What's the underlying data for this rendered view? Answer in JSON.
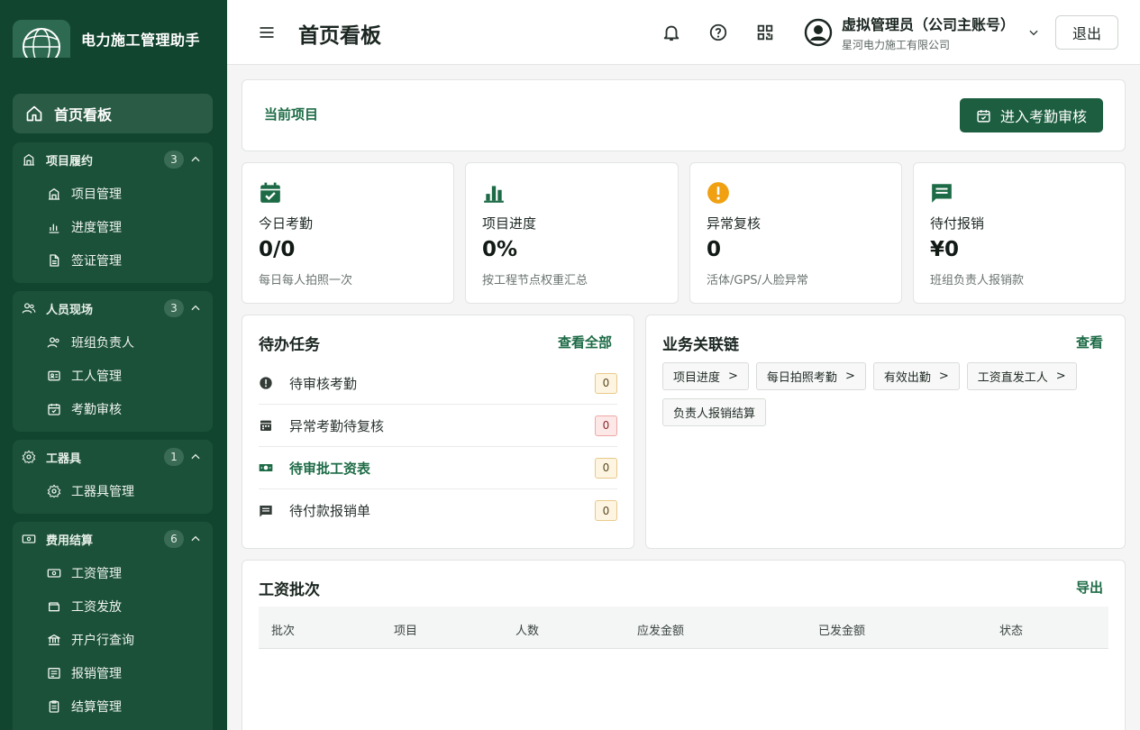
{
  "colors": {
    "sidebar_bg": "#12452f",
    "accent": "#1d6b46",
    "primary_button": "#1c5e3f",
    "warning": "#f0a011"
  },
  "app": {
    "title": "电力施工管理助手"
  },
  "sidebar": {
    "home": {
      "label": "首页看板",
      "icon": "home-icon"
    },
    "groups": [
      {
        "label": "项目履约",
        "count": "3",
        "icon": "building-icon",
        "items": [
          {
            "label": "项目管理",
            "icon": "building-icon"
          },
          {
            "label": "进度管理",
            "icon": "bar-chart-icon"
          },
          {
            "label": "签证管理",
            "icon": "document-icon"
          }
        ]
      },
      {
        "label": "人员现场",
        "count": "3",
        "icon": "users-icon",
        "items": [
          {
            "label": "班组负责人",
            "icon": "users-icon"
          },
          {
            "label": "工人管理",
            "icon": "id-card-icon"
          },
          {
            "label": "考勤审核",
            "icon": "calendar-check-icon"
          }
        ]
      },
      {
        "label": "工器具",
        "count": "1",
        "icon": "gear-icon",
        "items": [
          {
            "label": "工器具管理",
            "icon": "gear-icon"
          }
        ]
      },
      {
        "label": "费用结算",
        "count": "6",
        "icon": "money-icon",
        "items": [
          {
            "label": "工资管理",
            "icon": "money-icon"
          },
          {
            "label": "工资发放",
            "icon": "wallet-icon"
          },
          {
            "label": "开户行查询",
            "icon": "bank-icon"
          },
          {
            "label": "报销管理",
            "icon": "receipt-icon"
          },
          {
            "label": "结算管理",
            "icon": "clipboard-icon"
          }
        ]
      }
    ]
  },
  "header": {
    "page_title": "首页看板",
    "user_name": "虚拟管理员（公司主账号）",
    "org": "星河电力施工有限公司",
    "logout": "退出"
  },
  "project_bar": {
    "label": "当前项目",
    "button": "进入考勤审核"
  },
  "stats": [
    {
      "label": "今日考勤",
      "value": "0/0",
      "desc": "每日每人拍照一次",
      "icon": "calendar-check-icon"
    },
    {
      "label": "项目进度",
      "value": "0%",
      "desc": "按工程节点权重汇总",
      "icon": "bar-chart-icon"
    },
    {
      "label": "异常复核",
      "value": "0",
      "desc": "活体/GPS/人脸异常",
      "icon": "alert-icon"
    },
    {
      "label": "待付报销",
      "value": "¥0",
      "desc": "班组负责人报销款",
      "icon": "message-icon"
    }
  ],
  "tasks": {
    "title": "待办任务",
    "link": "查看全部",
    "items": [
      {
        "label": "待审核考勤",
        "count": "0",
        "icon": "alert-circle-icon"
      },
      {
        "label": "异常考勤待复核",
        "count": "0",
        "icon": "calendar-icon"
      },
      {
        "label": "待审批工资表",
        "count": "0",
        "icon": "money-icon"
      },
      {
        "label": "待付款报销单",
        "count": "0",
        "icon": "message-icon"
      }
    ]
  },
  "chain": {
    "title": "业务关联链",
    "link": "查看",
    "arrow": ">",
    "chips": [
      "项目进度",
      "每日拍照考勤",
      "有效出勤",
      "工资直发工人",
      "负责人报销结算"
    ]
  },
  "payroll": {
    "title": "工资批次",
    "link": "导出",
    "columns": [
      "批次",
      "项目",
      "人数",
      "应发金额",
      "已发金额",
      "状态"
    ]
  }
}
